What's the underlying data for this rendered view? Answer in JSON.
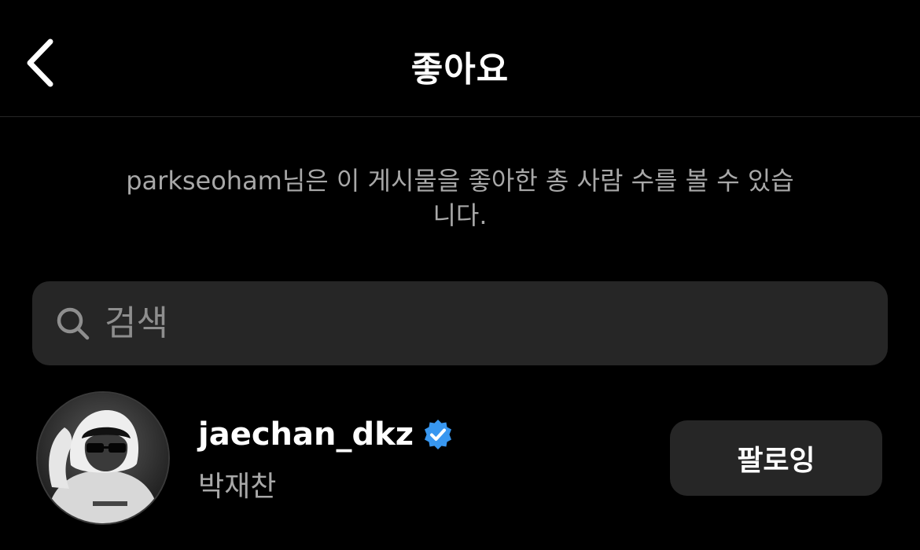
{
  "header": {
    "title": "좋아요",
    "back_icon": "chevron-left-icon"
  },
  "notice": {
    "text": "parkseoham님은 이 게시물을 좋아한 총 사람 수를 볼 수 있습니다."
  },
  "search": {
    "icon": "search-icon",
    "placeholder": "검색",
    "value": ""
  },
  "likes": [
    {
      "username": "jaechan_dkz",
      "full_name": "박재찬",
      "verified": true,
      "button_label": "팔로잉"
    }
  ],
  "colors": {
    "background": "#000000",
    "surface": "#262626",
    "divider": "#262626",
    "secondary_text": "#a8a8a8",
    "verified_badge": "#3897f0"
  }
}
